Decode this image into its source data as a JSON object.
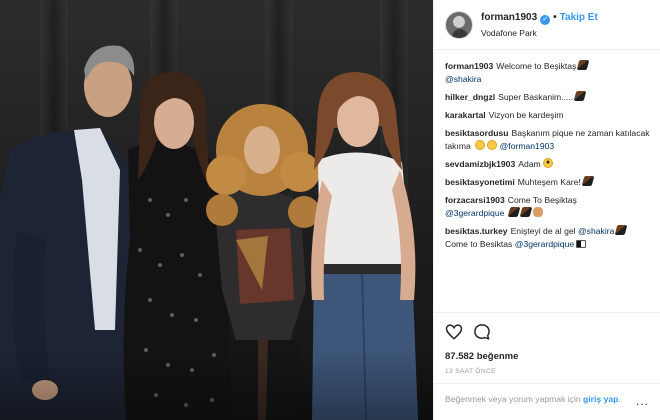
{
  "header": {
    "username": "forman1903",
    "verified_icon": "✓",
    "separator": "•",
    "follow_label": "Takip Et",
    "location": "Vodafone Park"
  },
  "comments": [
    {
      "user": "forman1903",
      "text": "Welcome to Beşiktaş",
      "mention": "@shakira",
      "emoji": [
        "eagle"
      ]
    },
    {
      "user": "hilker_dngzl",
      "text": "Super Baskanim.....",
      "emoji": [
        "eagle"
      ]
    },
    {
      "user": "karakartal",
      "text": "Vizyon be kardeşim",
      "emoji": []
    },
    {
      "user": "besiktasordusu",
      "text": "Başkanım pique ne zaman katılacak takıma",
      "mention": "@forman1903",
      "emoji": [
        "face",
        "face"
      ]
    },
    {
      "user": "sevdamizbjk1903",
      "text": "Adam",
      "emoji": [
        "cool"
      ]
    },
    {
      "user": "besiktasyonetimi",
      "text": "Muhteşem Kare!",
      "emoji": [
        "eagle"
      ]
    },
    {
      "user": "forzacarsi1903",
      "text": "Come To Beşiktaş",
      "mention": "@3gerardpique",
      "emoji": [
        "eagle",
        "eagle",
        "muscle"
      ]
    },
    {
      "user": "besiktas.turkey",
      "text": "Enişteyi de al gel",
      "mention": "@shakira",
      "text2": "Come to Besiktas",
      "mention2": "@3gerardpique",
      "emoji": [
        "eagle"
      ],
      "emoji2": [
        "flag"
      ]
    }
  ],
  "actions": {
    "like_icon": "heart-outline-icon",
    "comment_icon": "speech-bubble-icon",
    "likes": "87.582 beğenme",
    "time": "13 SAAT ÖNCE"
  },
  "login": {
    "text": "Beğenmek veya yorum yapmak için",
    "link": "giriş yap",
    "suffix": ".",
    "more": "..."
  },
  "colors": {
    "accent": "#3897f0",
    "mention": "#003569",
    "text": "#262626",
    "muted": "#999999",
    "divider": "#efefef"
  }
}
